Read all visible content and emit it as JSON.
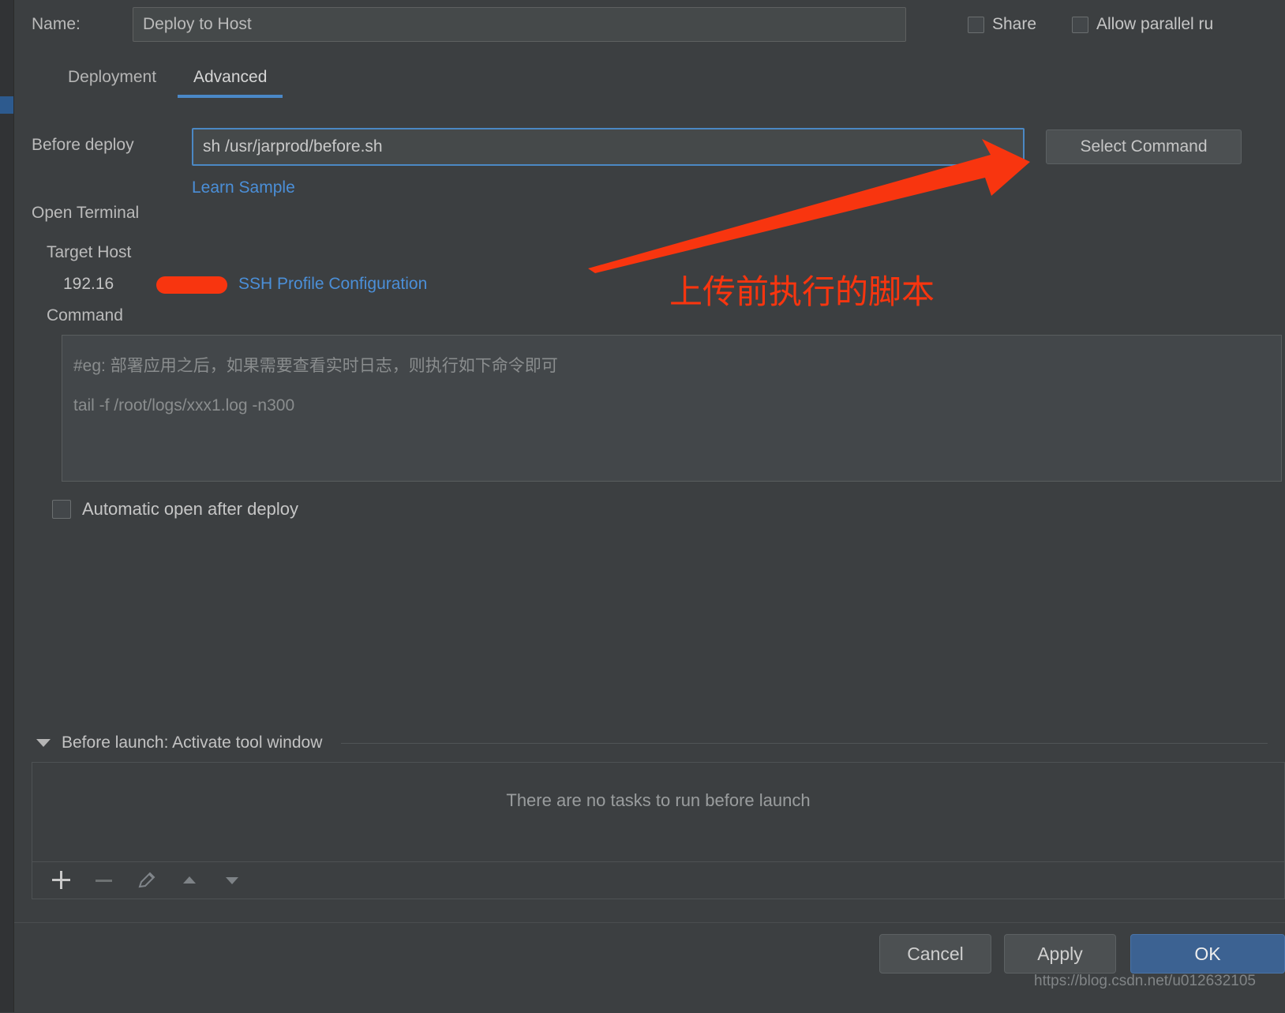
{
  "window": {
    "name_label": "Name:",
    "name_value": "Deploy to Host",
    "share_label": "Share",
    "parallel_label": "Allow parallel ru"
  },
  "tabs": [
    {
      "label": "Deployment",
      "selected": false
    },
    {
      "label": "Advanced",
      "selected": true
    }
  ],
  "advanced": {
    "before_deploy_label": "Before deploy",
    "before_deploy_value": "sh /usr/jarprod/before.sh",
    "select_command_label": "Select Command",
    "learn_sample_label": "Learn Sample",
    "open_terminal_label": "Open Terminal",
    "target_host_label": "Target Host",
    "host_ip": "192.16",
    "ssh_profile_label": "SSH Profile Configuration",
    "command_label": "Command",
    "command_placeholder_line1": "#eg: 部署应用之后，如果需要查看实时日志，则执行如下命令即可",
    "command_placeholder_line2": "tail -f /root/logs/xxx1.log -n300",
    "auto_open_label": "Automatic open after deploy"
  },
  "before_launch": {
    "title": "Before launch: Activate tool window",
    "empty_message": "There are no tasks to run before launch",
    "toolbar": [
      {
        "name": "add",
        "glyph": "+"
      },
      {
        "name": "remove",
        "glyph": "−"
      },
      {
        "name": "edit",
        "glyph": "pencil"
      },
      {
        "name": "move-up",
        "glyph": "▲"
      },
      {
        "name": "move-down",
        "glyph": "▼"
      }
    ]
  },
  "footer": {
    "cancel_label": "Cancel",
    "apply_label": "Apply",
    "ok_label": "OK",
    "watermark": "https://blog.csdn.net/u012632105"
  },
  "annotation": {
    "text": "上传前执行的脚本",
    "color": "#f8350f"
  },
  "colors": {
    "background": "#3c3f41",
    "field_background": "#45494a",
    "accent_blue": "#4b8fd8",
    "tab_underline": "#4a88c7",
    "ok_button": "#3c6292",
    "annotation_red": "#f8350f"
  }
}
